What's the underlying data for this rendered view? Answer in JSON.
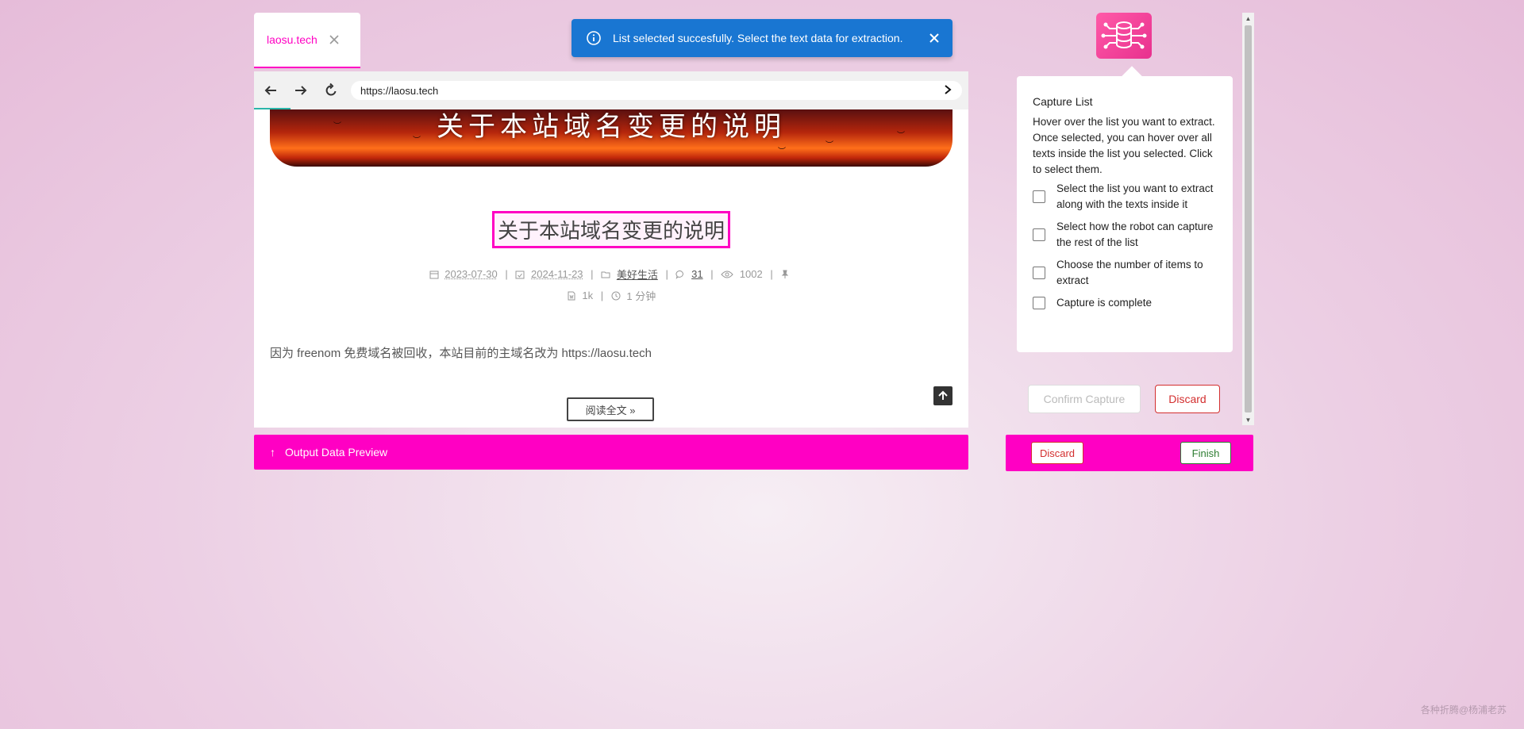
{
  "tab": {
    "label": "laosu.tech"
  },
  "address": {
    "url": "https://laosu.tech"
  },
  "page": {
    "banner_text": "关于本站域名变更的说明",
    "post_title": "关于本站域名变更的说明",
    "meta": {
      "published": "2023-07-30",
      "updated": "2024-11-23",
      "category": "美好生活",
      "comments": "31",
      "views": "1002",
      "words": "1k",
      "read_time": "1 分钟",
      "separator": "|"
    },
    "excerpt": "因为 freenom 免费域名被回收，本站目前的主域名改为 https://laosu.tech",
    "read_more": "阅读全文 »"
  },
  "output_preview": {
    "arrow": "↑",
    "label": "Output Data Preview"
  },
  "toast": {
    "message": "List selected succesfully. Select the text data for extraction."
  },
  "capture_panel": {
    "title": "Capture List",
    "description": "Hover over the list you want to extract. Once selected, you can hover over all texts inside the list you selected. Click to select them.",
    "steps": [
      {
        "label": "Select the list you want to extract along with the texts inside it",
        "checked": false
      },
      {
        "label": "Select how the robot can capture the rest of the list",
        "checked": false
      },
      {
        "label": "Choose the number of items to extract",
        "checked": false
      },
      {
        "label": "Capture is complete",
        "checked": false
      }
    ],
    "confirm_label": "Confirm Capture",
    "discard_label": "Discard"
  },
  "footer": {
    "discard_label": "Discard",
    "finish_label": "Finish"
  },
  "watermark": "各种折腾@杨浦老苏",
  "colors": {
    "accent": "#ff00c3",
    "toast": "#1976d2",
    "danger": "#d32f2f",
    "success": "#2e7d32"
  }
}
